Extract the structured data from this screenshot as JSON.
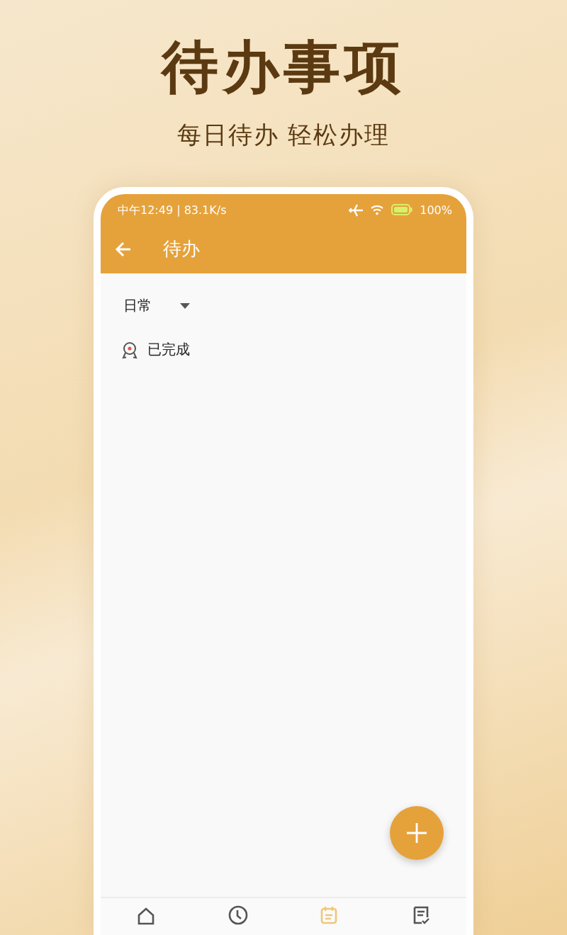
{
  "headline": {
    "title": "待办事项",
    "subtitle": "每日待办 轻松办理"
  },
  "status_bar": {
    "time": "中午12:49 | 83.1K/s",
    "battery": "100%"
  },
  "app_bar": {
    "title": "待办"
  },
  "category": {
    "value": "日常"
  },
  "sections": [
    {
      "label": "已完成"
    }
  ],
  "bottom_nav": [
    {
      "kind": "home",
      "selected": false
    },
    {
      "kind": "clock",
      "selected": false
    },
    {
      "kind": "calendar",
      "selected": true
    },
    {
      "kind": "checklist",
      "selected": false
    }
  ]
}
